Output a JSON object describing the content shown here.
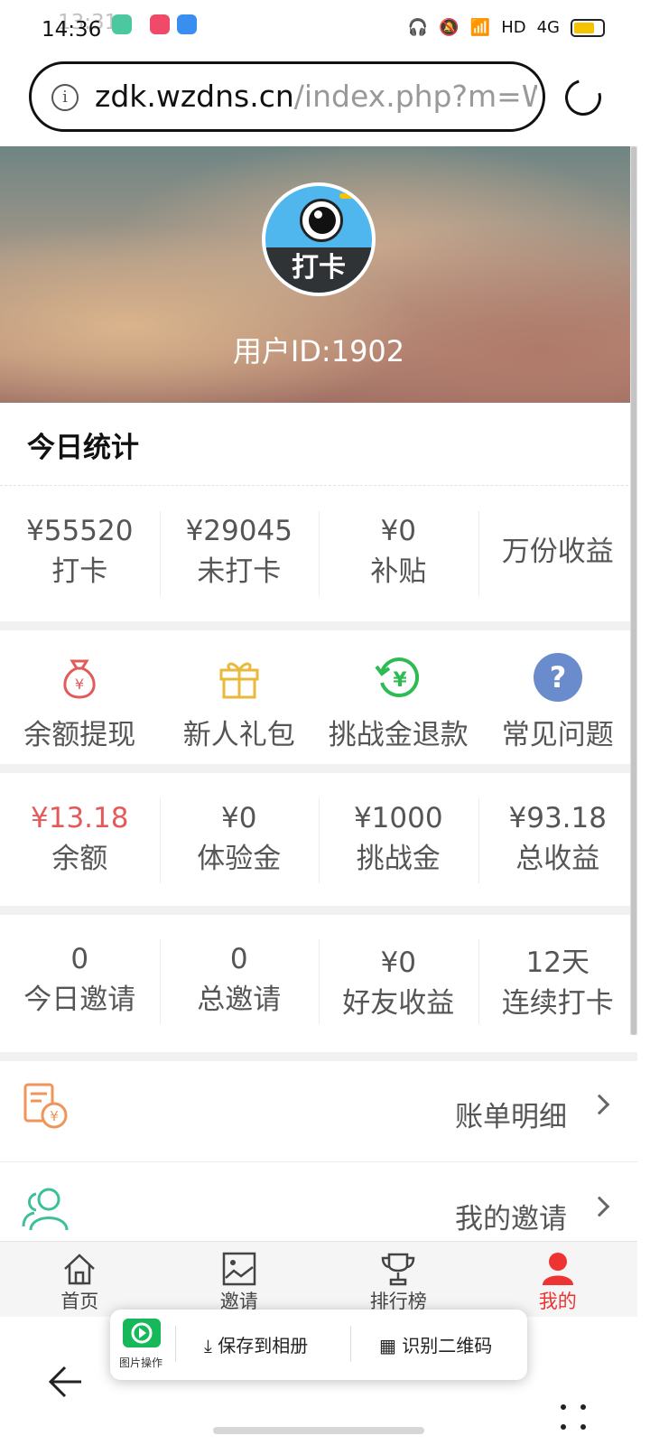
{
  "status_bar": {
    "time": "14:36",
    "time_ghost": "13:31",
    "network": "HD",
    "signal_label": "4G"
  },
  "browser": {
    "url_host": "zdk.wzdns.cn",
    "url_path": "/index.php?m=W"
  },
  "profile": {
    "avatar_text": "打卡",
    "user_id": "用户ID:1902"
  },
  "today_stats": {
    "title": "今日统计",
    "items": [
      {
        "value": "¥55520",
        "label": "打卡"
      },
      {
        "value": "¥29045",
        "label": "未打卡"
      },
      {
        "value": "¥0",
        "label": "补贴"
      },
      {
        "value": "",
        "label": "万份收益"
      }
    ]
  },
  "quick_actions": [
    {
      "icon": "money-bag-icon",
      "label": "余额提现"
    },
    {
      "icon": "gift-icon",
      "label": "新人礼包"
    },
    {
      "icon": "refund-yen-icon",
      "label": "挑战金退款"
    },
    {
      "icon": "question-icon",
      "label": "常见问题"
    }
  ],
  "balances": [
    {
      "value": "¥13.18",
      "label": "余额"
    },
    {
      "value": "¥0",
      "label": "体验金"
    },
    {
      "value": "¥1000",
      "label": "挑战金"
    },
    {
      "value": "¥93.18",
      "label": "总收益"
    }
  ],
  "invites": [
    {
      "value": "0",
      "label": "今日邀请"
    },
    {
      "value": "0",
      "label": "总邀请"
    },
    {
      "value": "¥0",
      "label": "好友收益"
    },
    {
      "value": "12天",
      "label": "连续打卡"
    }
  ],
  "list": [
    {
      "icon": "bill-icon",
      "label": "账单明细"
    },
    {
      "icon": "users-icon",
      "label": "我的邀请"
    }
  ],
  "tabs": [
    {
      "icon": "home-icon",
      "label": "首页"
    },
    {
      "icon": "invite-image-icon",
      "label": "邀请"
    },
    {
      "icon": "trophy-icon",
      "label": "排行榜"
    },
    {
      "icon": "person-icon",
      "label": "我的",
      "active": true
    }
  ],
  "popup": {
    "app_label": "图片操作",
    "save_label": "保存到相册",
    "scan_label": "识别二维码"
  },
  "colors": {
    "accent_red": "#e35a5a",
    "green": "#2dbb52",
    "orange": "#f0945a",
    "yellow": "#e8b93a",
    "blue": "#6b8ccc",
    "teal": "#3dbf9a"
  }
}
